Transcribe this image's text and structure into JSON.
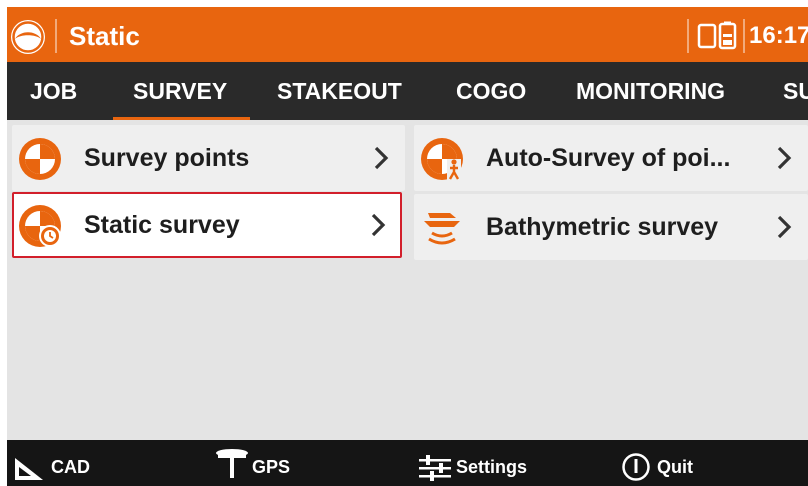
{
  "header": {
    "title": "Static",
    "time": "16:17",
    "accent_color": "#e8650f"
  },
  "tabs": [
    {
      "label": "JOB",
      "active": false
    },
    {
      "label": "SURVEY",
      "active": true
    },
    {
      "label": "STAKEOUT",
      "active": false
    },
    {
      "label": "COGO",
      "active": false
    },
    {
      "label": "MONITORING",
      "active": false
    },
    {
      "label": "SU",
      "active": false
    }
  ],
  "menu": [
    {
      "label": "Survey points",
      "icon": "survey-target-icon",
      "selected": false
    },
    {
      "label": "Static survey",
      "icon": "static-survey-icon",
      "selected": true
    },
    {
      "label": "Auto-Survey of poi...",
      "icon": "auto-survey-icon",
      "selected": false
    },
    {
      "label": "Bathymetric survey",
      "icon": "bathymetric-boat-icon",
      "selected": false
    }
  ],
  "bottom": [
    {
      "label": "CAD",
      "icon": "cad-angle-icon"
    },
    {
      "label": "GPS",
      "icon": "gps-antenna-icon"
    },
    {
      "label": "Settings",
      "icon": "settings-sliders-icon"
    },
    {
      "label": "Quit",
      "icon": "power-icon"
    }
  ],
  "selection_color": "#d21f2b"
}
